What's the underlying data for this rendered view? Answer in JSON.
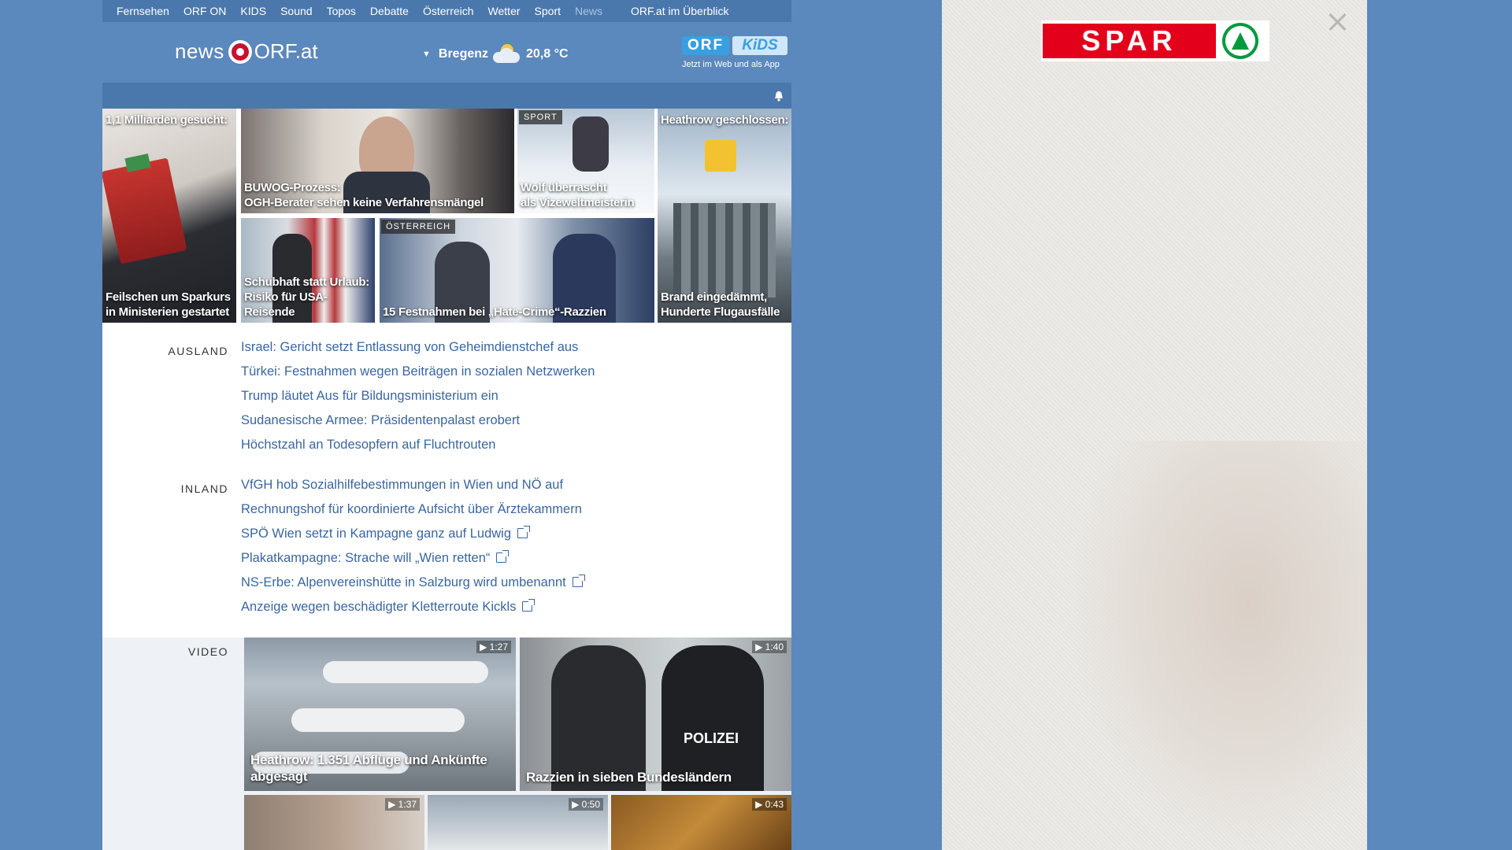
{
  "nav": {
    "items": [
      {
        "label": "Fernsehen"
      },
      {
        "label": "ORF ON"
      },
      {
        "label": "KIDS"
      },
      {
        "label": "Sound"
      },
      {
        "label": "Topos"
      },
      {
        "label": "Debatte"
      },
      {
        "label": "Österreich"
      },
      {
        "label": "Wetter"
      },
      {
        "label": "Sport"
      },
      {
        "label": "News"
      }
    ],
    "active": "News",
    "overview": "ORF.at im Überblick"
  },
  "header": {
    "logo_news": "news",
    "logo_orf": "ORF.at",
    "weather_city": "Bregenz",
    "weather_temp": "20,8 °C",
    "kids_orf": "ORF",
    "kids_label": "KiDS",
    "kids_sub": "Jetzt im Web und als App"
  },
  "top_stories": [
    {
      "id": "s1",
      "caption_top": "1,1 Milliarden gesucht:",
      "caption": "Feilschen um Sparkurs\nin Ministerien gestartet"
    },
    {
      "id": "s2",
      "caption": "BUWOG-Prozess:\nOGH-Berater sehen keine Verfahrensmängel"
    },
    {
      "id": "s3",
      "tag": "SPORT",
      "caption": "Wolf überrascht\nals Vizeweltmeisterin"
    },
    {
      "id": "s4",
      "caption_top": "Heathrow geschlossen:",
      "caption": "Brand eingedämmt,\nHunderte Flugausfälle"
    },
    {
      "id": "s5",
      "caption": "Schubhaft statt Urlaub:\nRisiko für USA-Reisende"
    },
    {
      "id": "s6",
      "tag": "ÖSTERREICH",
      "caption": "15 Festnahmen bei „Hate-Crime“-Razzien"
    }
  ],
  "ausland": {
    "label": "AUSLAND",
    "items": [
      {
        "text": "Israel: Gericht setzt Entlassung von Geheimdienstchef aus"
      },
      {
        "text": "Türkei: Festnahmen wegen Beiträgen in sozialen Netzwerken"
      },
      {
        "text": "Trump läutet Aus für Bildungsministerium ein"
      },
      {
        "text": "Sudanesische Armee: Präsidentenpalast erobert"
      },
      {
        "text": "Höchstzahl an Todesopfern auf Fluchtrouten"
      }
    ]
  },
  "inland": {
    "label": "INLAND",
    "items": [
      {
        "text": "VfGH hob Sozialhilfebestimmungen in Wien und NÖ auf",
        "external": false
      },
      {
        "text": "Rechnungshof für koordinierte Aufsicht über Ärztekammern",
        "external": false
      },
      {
        "text": "SPÖ Wien setzt in Kampagne ganz auf Ludwig",
        "external": true
      },
      {
        "text": "Plakatkampagne: Strache will „Wien retten“",
        "external": true
      },
      {
        "text": "NS-Erbe: Alpenvereinshütte in Salzburg wird umbenannt",
        "external": true
      },
      {
        "text": "Anzeige wegen beschädigter Kletterroute Kickls",
        "external": true
      }
    ]
  },
  "video": {
    "label": "VIDEO",
    "items": [
      {
        "caption": "Heathrow: 1.351 Abflüge und Ankünfte\nabgesagt",
        "duration": "▶ 1:27"
      },
      {
        "caption": "Razzien in sieben Bundesländern",
        "duration": "▶ 1:40"
      },
      {
        "caption": "",
        "duration": "▶ 1:37"
      },
      {
        "caption": "",
        "duration": "▶ 0:50"
      },
      {
        "caption": "",
        "duration": "▶ 0:43"
      }
    ]
  },
  "ad": {
    "brand": "SPAR"
  },
  "colors": {
    "background": "#5b88bd",
    "nav": "#4a78ad",
    "link": "#3a66a0",
    "spar_red": "#e3001b",
    "spar_green": "#009a3e"
  }
}
